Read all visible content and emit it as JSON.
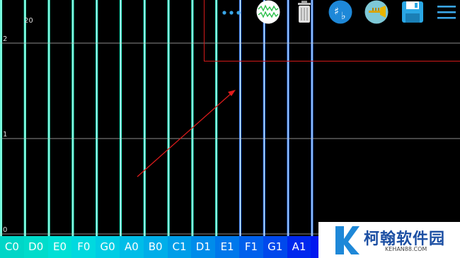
{
  "axis": {
    "scale_label": "20",
    "y_ticks": [
      "2",
      "1",
      "0"
    ]
  },
  "note_keys": [
    "C0",
    "D0",
    "E0",
    "F0",
    "G0",
    "A0",
    "B0",
    "C1",
    "D1",
    "E1",
    "F1",
    "G1",
    "A1"
  ],
  "key_colors": [
    "#00d6c7",
    "#00dccb",
    "#00e0d6",
    "#00d9df",
    "#00cde4",
    "#00bde8",
    "#00aee9",
    "#009ee9",
    "#008cea",
    "#0078eb",
    "#0060ec",
    "#0048ec",
    "#0028ee"
  ],
  "colors": {
    "string_glow": "#1cf3c8",
    "string_core": "#f2fff9",
    "gridline": "#bdbdbd",
    "arrow": "#e01c1c",
    "toolbar_border": "#d21a1a"
  },
  "toolbar": {
    "icons": [
      "more-icon",
      "waveform-icon",
      "trash-icon",
      "sharp-flat-icon",
      "trumpet-icon",
      "save-icon",
      "menu-icon"
    ]
  },
  "watermark": {
    "title": "柯翰软件园",
    "subtitle": "KEHAN88.COM"
  }
}
